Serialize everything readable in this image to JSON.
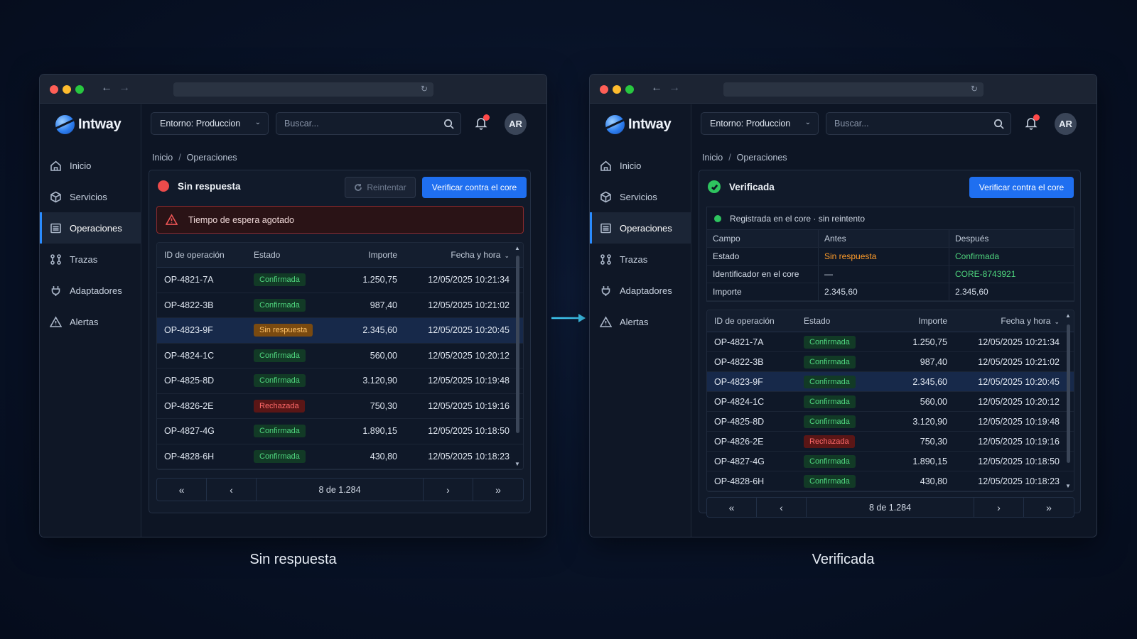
{
  "brand": "Intway",
  "nav": [
    {
      "label": "Inicio",
      "icon": "home-icon"
    },
    {
      "label": "Servicios",
      "icon": "cube-icon"
    },
    {
      "label": "Operaciones",
      "icon": "list-icon"
    },
    {
      "label": "Trazas",
      "icon": "trace-icon"
    },
    {
      "label": "Adaptadores",
      "icon": "plug-icon"
    },
    {
      "label": "Alertas",
      "icon": "warning-icon"
    }
  ],
  "topbar": {
    "environment": "Entorno: Produccion",
    "search_placeholder": "Buscar...",
    "avatar": "AR"
  },
  "breadcrumb": {
    "home": "Inicio",
    "separator": "/",
    "current": "Operaciones"
  },
  "table_headers": {
    "id": "ID de operación",
    "status": "Estado",
    "amount": "Importe",
    "date": "Fecha y hora",
    "sort_icon": "⌄"
  },
  "pager": {
    "first": "«",
    "prev": "‹",
    "info": "8 de 1.284",
    "next": "›",
    "last": "»"
  },
  "scroll": {
    "up": "▲",
    "down": "▼"
  },
  "left": {
    "caption": "Sin respuesta",
    "status": "Sin respuesta",
    "retry_label": "Reintentar",
    "verify_label": "Verificar contra el core",
    "alert": "Tiempo de espera agotado",
    "rows": [
      {
        "id": "OP-4821-7A",
        "status": "Confirmada",
        "kind": "ok",
        "amount": "1.250,75",
        "date": "12/05/2025 10:21:34"
      },
      {
        "id": "OP-4822-3B",
        "status": "Confirmada",
        "kind": "ok",
        "amount": "987,40",
        "date": "12/05/2025 10:21:02"
      },
      {
        "id": "OP-4823-9F",
        "status": "Sin respuesta",
        "kind": "warn",
        "amount": "2.345,60",
        "date": "12/05/2025 10:20:45"
      },
      {
        "id": "OP-4824-1C",
        "status": "Confirmada",
        "kind": "ok",
        "amount": "560,00",
        "date": "12/05/2025 10:20:12"
      },
      {
        "id": "OP-4825-8D",
        "status": "Confirmada",
        "kind": "ok",
        "amount": "3.120,90",
        "date": "12/05/2025 10:19:48"
      },
      {
        "id": "OP-4826-2E",
        "status": "Rechazada",
        "kind": "err",
        "amount": "750,30",
        "date": "12/05/2025 10:19:16"
      },
      {
        "id": "OP-4827-4G",
        "status": "Confirmada",
        "kind": "ok",
        "amount": "1.890,15",
        "date": "12/05/2025 10:18:50"
      },
      {
        "id": "OP-4828-6H",
        "status": "Confirmada",
        "kind": "ok",
        "amount": "430,80",
        "date": "12/05/2025 10:18:23"
      }
    ]
  },
  "right": {
    "caption": "Verificada",
    "status": "Verificada",
    "verify_label": "Verificar contra el core",
    "info": "Registrada en el core · sin reintento",
    "compare": {
      "headers": [
        "Campo",
        "Antes",
        "Después"
      ],
      "rows": [
        {
          "field": "Estado",
          "before": "Sin respuesta",
          "after": "Confirmada"
        },
        {
          "field": "Identificador en el core",
          "before": "—",
          "after": "CORE-8743921"
        },
        {
          "field": "Importe",
          "before": "2.345,60",
          "after": "2.345,60"
        }
      ]
    },
    "rows": [
      {
        "id": "OP-4821-7A",
        "status": "Confirmada",
        "kind": "ok",
        "amount": "1.250,75",
        "date": "12/05/2025 10:21:34"
      },
      {
        "id": "OP-4822-3B",
        "status": "Confirmada",
        "kind": "ok",
        "amount": "987,40",
        "date": "12/05/2025 10:21:02"
      },
      {
        "id": "OP-4823-9F",
        "status": "Confirmada",
        "kind": "ok",
        "amount": "2.345,60",
        "date": "12/05/2025 10:20:45"
      },
      {
        "id": "OP-4824-1C",
        "status": "Confirmada",
        "kind": "ok",
        "amount": "560,00",
        "date": "12/05/2025 10:20:12"
      },
      {
        "id": "OP-4825-8D",
        "status": "Confirmada",
        "kind": "ok",
        "amount": "3.120,90",
        "date": "12/05/2025 10:19:48"
      },
      {
        "id": "OP-4826-2E",
        "status": "Rechazada",
        "kind": "err",
        "amount": "750,30",
        "date": "12/05/2025 10:19:16"
      },
      {
        "id": "OP-4827-4G",
        "status": "Confirmada",
        "kind": "ok",
        "amount": "1.890,15",
        "date": "12/05/2025 10:18:50"
      },
      {
        "id": "OP-4828-6H",
        "status": "Confirmada",
        "kind": "ok",
        "amount": "430,80",
        "date": "12/05/2025 10:18:23"
      }
    ]
  },
  "colors": {
    "accent": "#1f6ff0",
    "ok": "#4fd67e",
    "warn": "#ff9c2a",
    "error": "#ec4b4b"
  }
}
